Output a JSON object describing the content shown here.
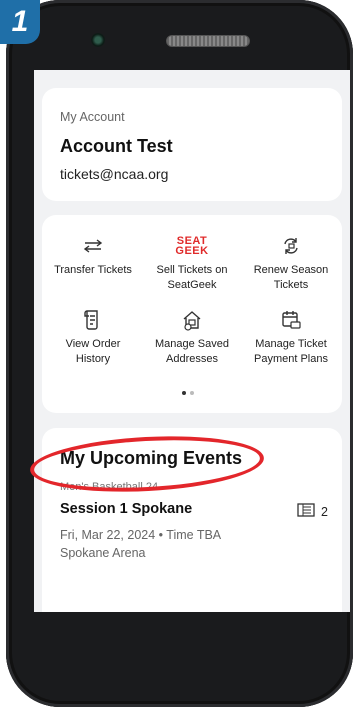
{
  "step_badge": "1",
  "account": {
    "section_label": "My Account",
    "name": "Account Test",
    "email": "tickets@ncaa.org"
  },
  "actions": [
    {
      "icon": "transfer-arrows-icon",
      "label": "Transfer Tickets"
    },
    {
      "icon": "seatgeek-logo",
      "logo_line1": "SEAT",
      "logo_line2": "GEEK",
      "label": "Sell Tickets on SeatGeek"
    },
    {
      "icon": "renew-icon",
      "label": "Renew Season Tickets"
    },
    {
      "icon": "receipt-icon",
      "label": "View Order History"
    },
    {
      "icon": "home-address-icon",
      "label": "Manage Saved Addresses"
    },
    {
      "icon": "calendar-payment-icon",
      "label": "Manage Ticket Payment Plans"
    }
  ],
  "pager": {
    "pages": 2,
    "active": 1
  },
  "events": {
    "title": "My Upcoming Events",
    "category": "Men's Basketball 24",
    "items": [
      {
        "name": "Session 1 Spokane",
        "date": "Fri, Mar 22, 2024 • Time TBA",
        "venue": "Spokane Arena",
        "ticket_count": "2"
      }
    ]
  },
  "colors": {
    "badge": "#1f6fa8",
    "highlight": "#e3262b",
    "seatgeek": "#e02b2b"
  }
}
